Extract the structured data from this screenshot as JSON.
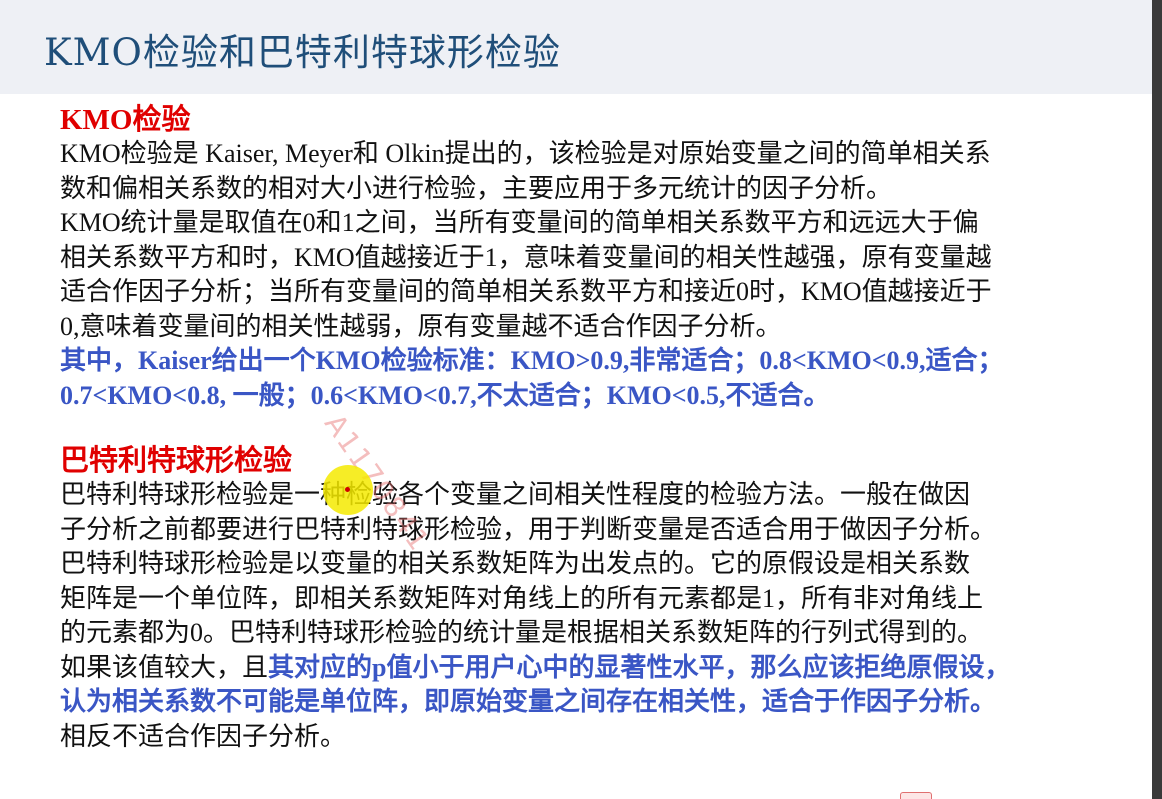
{
  "slide": {
    "title": "KMO检验和巴特利特球形检验",
    "watermark": "A1170841",
    "kmo_section": {
      "heading": "KMO检验",
      "lines": [
        "KMO检验是 Kaiser, Meyer和 Olkin提出的，该检验是对原始变量之间的简单相关系",
        "数和偏相关系数的相对大小进行检验，主要应用于多元统计的因子分析。",
        "KMO统计量是取值在0和1之间，当所有变量间的简单相关系数平方和远远大于偏",
        "相关系数平方和时，KMO值越接近于1，意味着变量间的相关性越强，原有变量越",
        "适合作因子分析；当所有变量间的简单相关系数平方和接近0时，KMO值越接近于",
        "0,意味着变量间的相关性越弱，原有变量越不适合作因子分析。"
      ],
      "standard_lines": [
        "其中，Kaiser给出一个KMO检验标准：KMO>0.9,非常适合；0.8<KMO<0.9,适合；",
        "0.7<KMO<0.8, 一般；0.6<KMO<0.7,不太适合；KMO<0.5,不适合。"
      ]
    },
    "bartlett_section": {
      "heading": "巴特利特球形检验",
      "lines": [
        "巴特利特球形检验是一种检验各个变量之间相关性程度的检验方法。一般在做因",
        "子分析之前都要进行巴特利特球形检验，用于判断变量是否适合用于做因子分析。",
        "巴特利特球形检验是以变量的相关系数矩阵为出发点的。它的原假设是相关系数",
        "矩阵是一个单位阵，即相关系数矩阵对角线上的所有元素都是1，所有非对角线上",
        "的元素都为0。巴特利特球形检验的统计量是根据相关系数矩阵的行列式得到的。"
      ],
      "mixed_line_prefix": "如果该值较大，且",
      "mixed_line_highlight": "其对应的p值小于用户心中的显著性水平，那么应该拒绝原假设，",
      "highlight_line": "认为相关系数不可能是单位阵，即原始变量之间存在相关性，适合于作因子分析。",
      "last_line": "相反不适合作因子分析。"
    },
    "colors": {
      "title": "#1f4e79",
      "heading": "#e00000",
      "emphasis": "#3a56c5",
      "title_bar": "#eef0f5"
    }
  }
}
